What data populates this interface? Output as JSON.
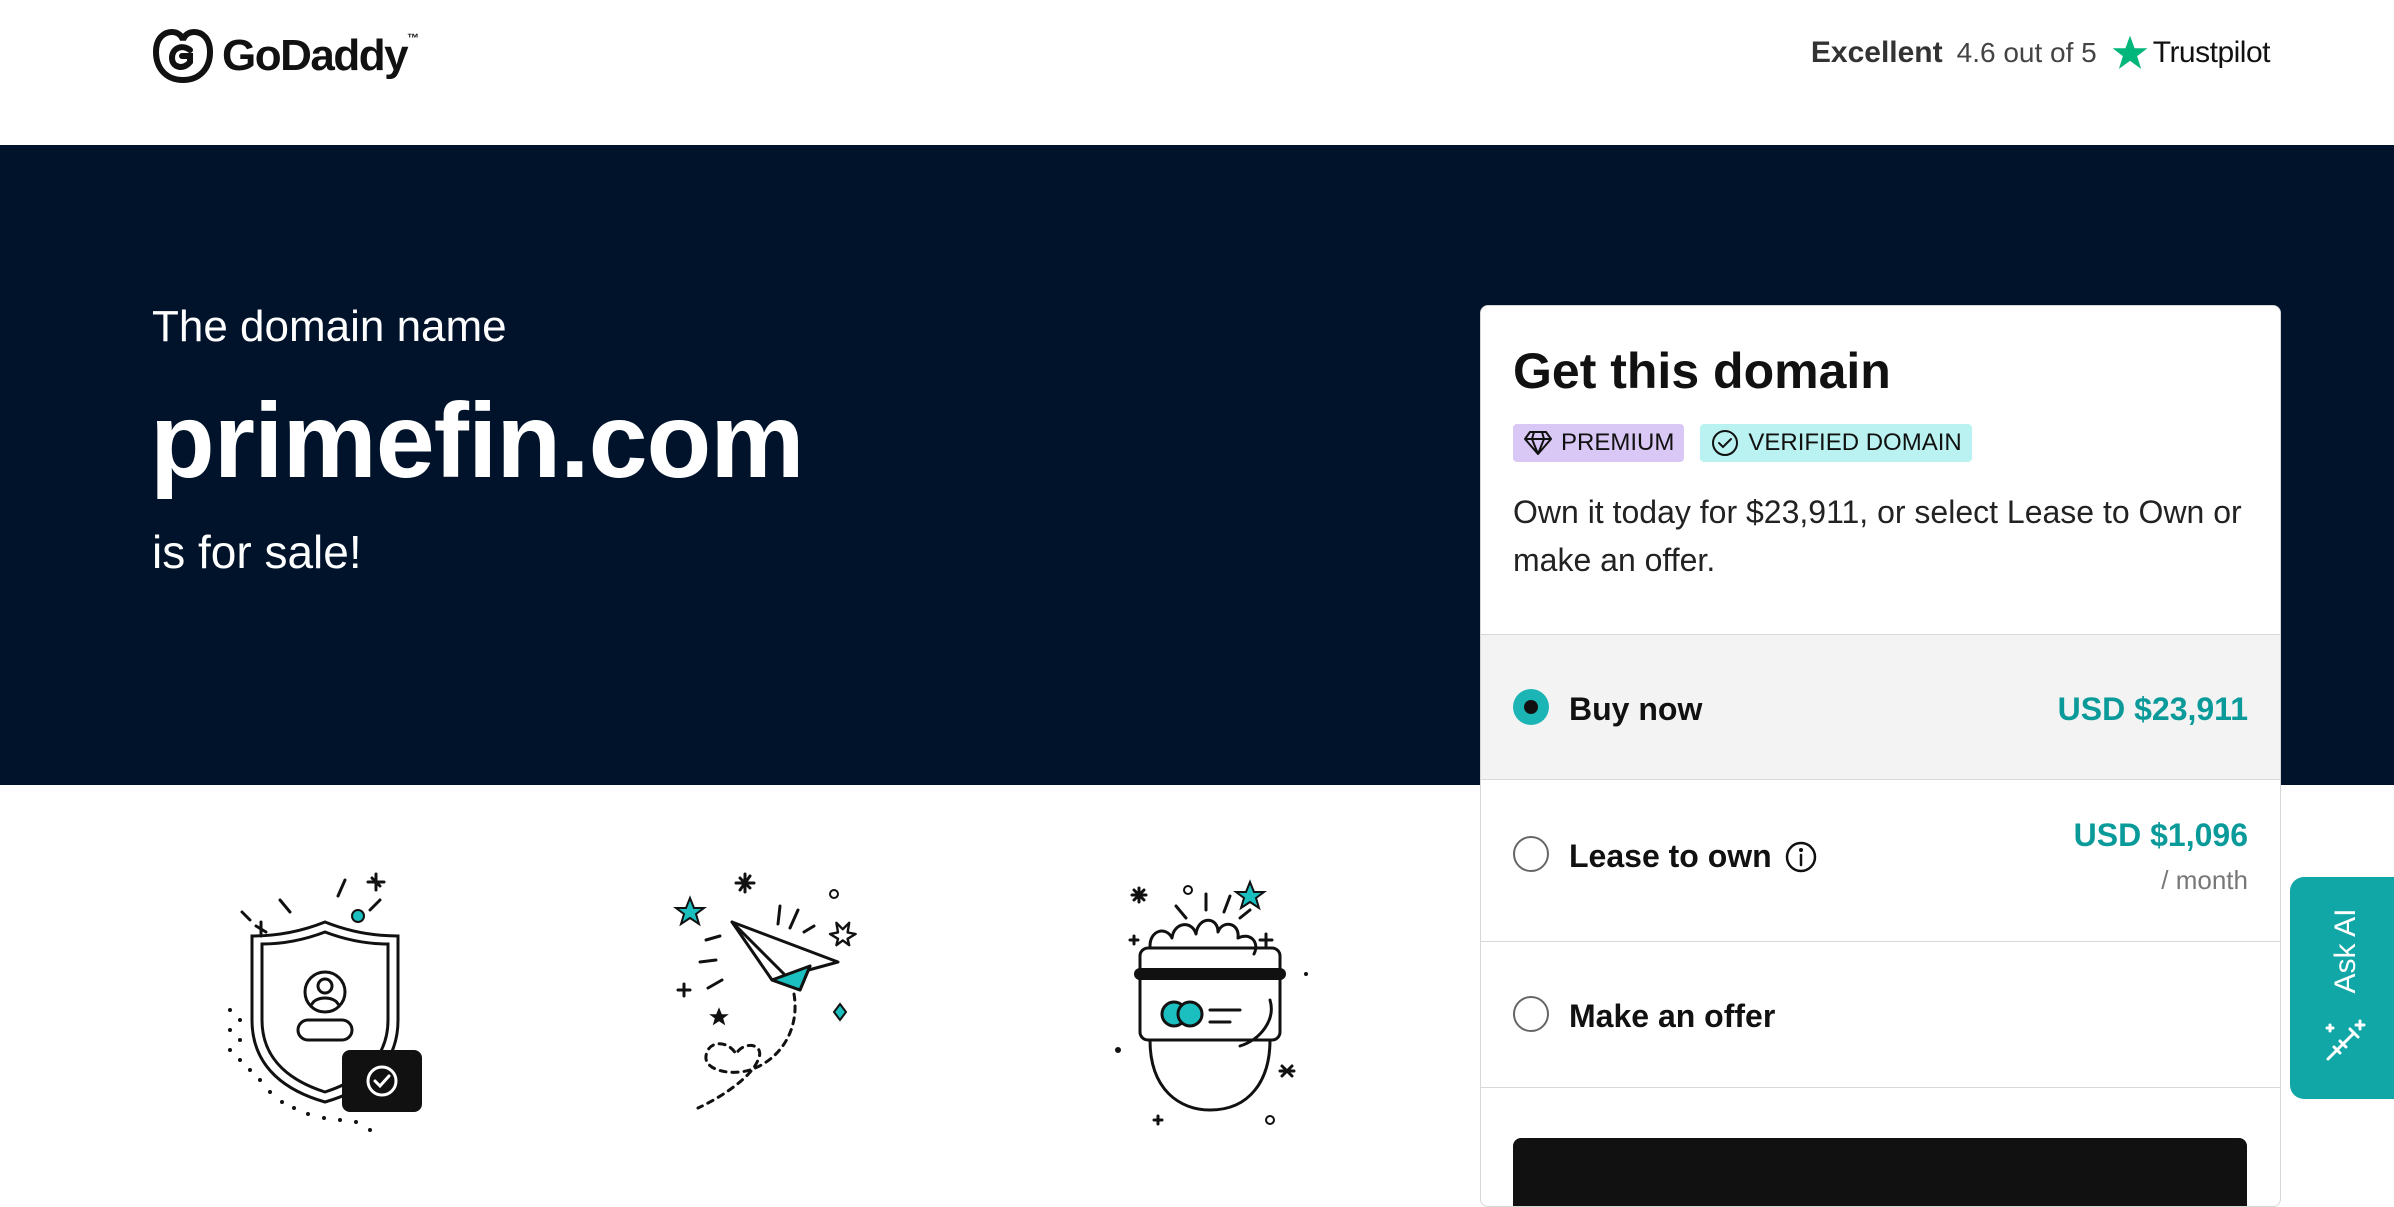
{
  "header": {
    "logo_text": "GoDaddy",
    "trustpilot": {
      "rating_word": "Excellent",
      "rating_text": "4.6 out of 5",
      "brand": "Trustpilot"
    }
  },
  "hero": {
    "pre_text": "The domain name",
    "domain": "primefin.com",
    "post_text": "is for sale!"
  },
  "card": {
    "title": "Get this domain",
    "badges": [
      "PREMIUM",
      "VERIFIED DOMAIN"
    ],
    "description": "Own it today for $23,911, or select Lease to Own or make an offer.",
    "options": [
      {
        "label": "Buy now",
        "price": "USD $23,911",
        "selected": true
      },
      {
        "label": "Lease to own",
        "price": "USD $1,096",
        "period": "/ month",
        "selected": false
      },
      {
        "label": "Make an offer",
        "selected": false
      }
    ]
  },
  "ask_ai": {
    "label": "Ask AI"
  },
  "colors": {
    "hero_bg": "#00132b",
    "accent": "#12a7a7",
    "price": "#0a9a9a",
    "premium_badge": "#d9c8f5",
    "verified_badge": "#b9f2f0"
  },
  "icons": [
    "godaddy-logo-icon",
    "trustpilot-star-icon",
    "diamond-icon",
    "check-circle-icon",
    "info-icon",
    "shield-user-icon",
    "paper-plane-icon",
    "credit-card-hand-icon",
    "magic-wand-icon"
  ]
}
